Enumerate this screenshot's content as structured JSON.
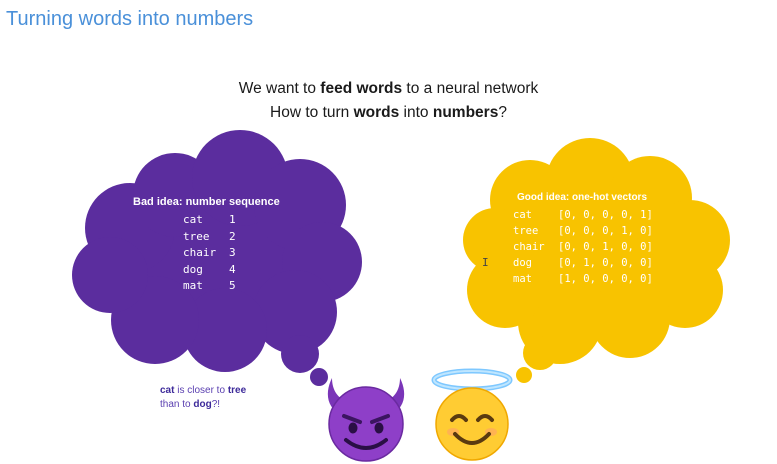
{
  "slide": {
    "title": "Turning words into numbers",
    "line1": {
      "pre": "We want to ",
      "bold": "feed words",
      "post": " to a neural network"
    },
    "line2": {
      "pre": "How to turn ",
      "bold1": "words",
      "mid": " into ",
      "bold2": "numbers",
      "post": "?"
    }
  },
  "bad_idea": {
    "heading": "Bad idea: number sequence",
    "rows": [
      {
        "word": "cat",
        "value": "1"
      },
      {
        "word": "tree",
        "value": "2"
      },
      {
        "word": "chair",
        "value": "3"
      },
      {
        "word": "dog",
        "value": "4"
      },
      {
        "word": "mat",
        "value": "5"
      }
    ],
    "color": "#5b2d9e"
  },
  "good_idea": {
    "heading": "Good idea: one-hot vectors",
    "rows": [
      {
        "word": "cat",
        "value": "[0, 0, 0, 0, 1]"
      },
      {
        "word": "tree",
        "value": "[0, 0, 0, 1, 0]"
      },
      {
        "word": "chair",
        "value": "[0, 0, 1, 0, 0]"
      },
      {
        "word": "dog",
        "value": "[0, 1, 0, 0, 0]"
      },
      {
        "word": "mat",
        "value": "[1, 0, 0, 0, 0]"
      }
    ],
    "color": "#f8c300"
  },
  "note": {
    "w1": "cat",
    "t1": " is closer to ",
    "w2": "tree",
    "t2": "than to ",
    "w3": "dog",
    "t3": "?!"
  },
  "emojis": {
    "devil": "smiling-devil-emoji",
    "angel": "smiling-angel-emoji"
  },
  "cursor": {
    "glyph": "I"
  }
}
